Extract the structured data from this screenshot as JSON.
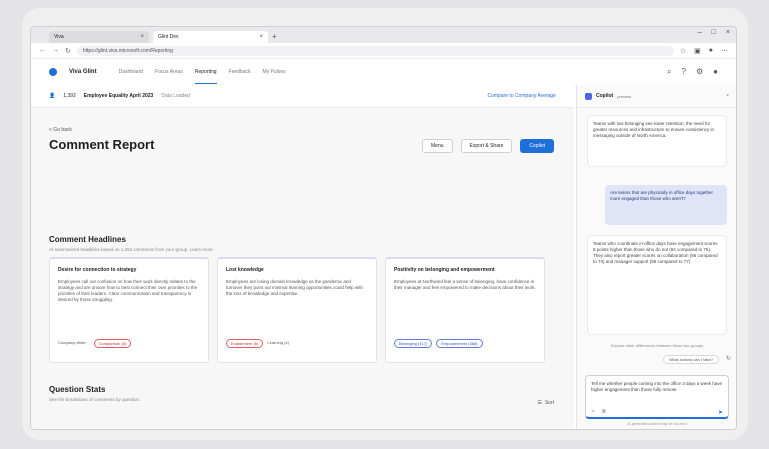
{
  "browser": {
    "tabs": [
      {
        "label": "Viva",
        "close": "×"
      },
      {
        "label": "Glint Dev",
        "close": "×"
      }
    ],
    "new_tab": "+",
    "window_controls": [
      "–",
      "□",
      "×"
    ],
    "url": "https://glint.viva.microsoft.com/Reporting",
    "nav_back": "←",
    "nav_forward": "→",
    "nav_refresh": "↻"
  },
  "appnav": {
    "brand": "Viva Glint",
    "links": [
      "Dashboard",
      "Focus Areas",
      "Reporting",
      "Feedback",
      "My Pulses"
    ],
    "active": "Reporting"
  },
  "filterbar": {
    "scope": "1,392",
    "survey": "Employee Equality April 2023",
    "view": "Data Loaded",
    "link": "Compare to Company Average"
  },
  "page": {
    "back": "< Go back",
    "title": "Comment Report",
    "actions": {
      "more": "Menu",
      "export": "Export & Share",
      "copilot": "Copilot"
    }
  },
  "headlines": {
    "title": "Comment Headlines",
    "subtitle": "AI-summarized headlines based on 1,392 comments from your group. Learn more.",
    "cards": [
      {
        "title": "Desire for connection to strategy",
        "body": "Employees call out confusion on how their work directly relates to the strategy and are unsure how to best connect their own priorities to the priorities of their leaders. Clear communication and transparency is desired by those struggling.",
        "chips": [
          {
            "label": "Company-Wide",
            "style": "plain"
          },
          {
            "label": "Comparison (8)",
            "style": "red"
          }
        ]
      },
      {
        "title": "Lost knowledge",
        "body": "Employees are losing domain knowledge as the pandemic and turnover they point out minimal learning opportunities could help with the loss of knowledge and expertise.",
        "chips": [
          {
            "label": "Enablement (6)",
            "style": "red"
          },
          {
            "label": "Learning (4)",
            "style": "plain"
          }
        ]
      },
      {
        "title": "Positivity on belonging and empowerment",
        "body": "Employees at Northwind feel a sense of belonging, have confidence in their manager and feel empowered to make decisions about their work.",
        "chips": [
          {
            "label": "Belonging (417)",
            "style": "blue"
          },
          {
            "label": "Empowerment (368)",
            "style": "blue"
          }
        ]
      }
    ]
  },
  "question_stats": {
    "title": "Question Stats",
    "subtitle": "See the breakdown of comments by question.",
    "sort": "Sort"
  },
  "copilot": {
    "name": "Copilot",
    "badge": "preview",
    "close": "×",
    "messages": [
      {
        "role": "bot",
        "text": "Teams with low belonging see lower retention, the need for greater resources and infrastructure to ensure consistency in messaging outside of North America."
      },
      {
        "role": "user",
        "text": "Are teams that are physically in office days together more engaged than those who aren't?"
      },
      {
        "role": "bot",
        "text": "Teams who coordinate in-office days have engagement scores 8 points higher than those who do not (84 compared to 76). They also report greater scores on collaboration (86 compared to 74) and manager support (85 compared to 77)."
      }
    ],
    "hint": "Explore other differences between these two groups",
    "suggestion": "What actions can I take?",
    "refresh_icon": "↻",
    "input_text": "Tell me whether people coming into the office 3 days a week have higher engagement than those fully remote",
    "send_icon": "➤",
    "footer": "AI-generated content may be incorrect"
  }
}
